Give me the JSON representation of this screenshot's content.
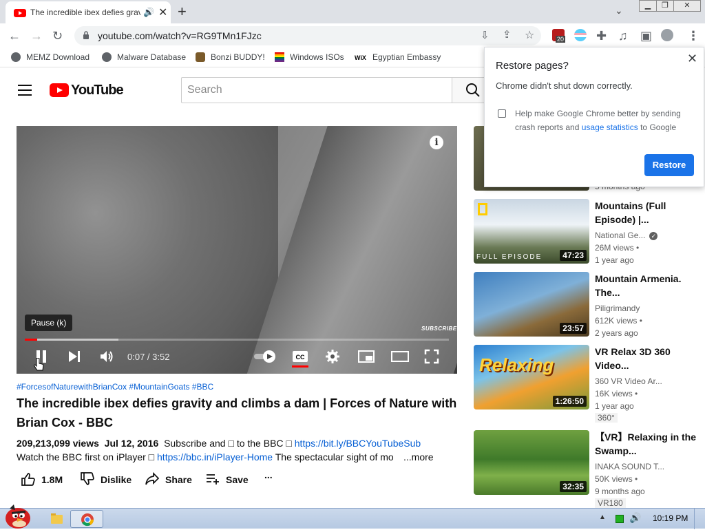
{
  "browser": {
    "tab_title": "The incredible ibex defies gravity and climbs a dam",
    "new_tab_label": "+",
    "url": "youtube.com/watch?v=RG9TMn1FJzc",
    "extension_badge": "20",
    "window_controls": [
      "minimize-button",
      "maximize-button",
      "close-button"
    ]
  },
  "bookmarks": [
    {
      "label": "MEMZ Download",
      "icon": "globe-icon"
    },
    {
      "label": "Malware Database",
      "icon": "globe-icon"
    },
    {
      "label": "Bonzi BUDDY!",
      "icon": "bonzi-icon"
    },
    {
      "label": "Windows ISOs",
      "icon": "windows-flag-icon"
    },
    {
      "label": "Egyptian Embassy",
      "icon": "wix-icon"
    }
  ],
  "youtube": {
    "logo_text": "YouTube",
    "search_placeholder": "Search"
  },
  "player": {
    "tooltip": "Pause (k)",
    "time": "0:07 / 3:52",
    "watermark": "SUBSCRIBE",
    "progress_played": 0.03,
    "progress_loaded": 0.22
  },
  "video": {
    "hashtags": "#ForcesofNaturewithBrianCox #MountainGoats #BBC",
    "title": "The incredible ibex defies gravity and climbs a dam | Forces of Nature with Brian Cox - BBC",
    "views": "209,213,099 views",
    "date": "Jul 12, 2016",
    "desc_a": "Subscribe and □ to the BBC □",
    "desc_link1": "https://bit.ly/BBCYouTubeSub",
    "desc_b": "Watch the BBC first on iPlayer □",
    "desc_link2": "https://bbc.in/iPlayer-Home",
    "desc_c": "The spectacular sight of mo",
    "more": "...more",
    "likes": "1.8M",
    "dislike": "Dislike",
    "share": "Share",
    "save": "Save",
    "overflow": "..."
  },
  "sidebar": [
    {
      "title": "",
      "channel": "",
      "views": "",
      "age": "5 months ago",
      "duration": ""
    },
    {
      "title": "Mountains (Full Episode) |...",
      "channel": "National Ge...",
      "views": "26M views •",
      "age": "1 year ago",
      "duration": "47:23",
      "overlay": "FULL EPISODE"
    },
    {
      "title": "Mountain Armenia. The...",
      "channel": "Piligrimandy",
      "views": "612K views •",
      "age": "2 years ago",
      "duration": "23:57"
    },
    {
      "title": "VR Relax 3D 360 Video...",
      "channel": "360 VR Video Ar...",
      "views": "16K views •",
      "age": "1 year ago",
      "duration": "1:26:50",
      "tag": "360°",
      "overlay": "Relaxing"
    },
    {
      "title": "【VR】Relaxing in the Swamp...",
      "channel": "INAKA SOUND T...",
      "views": "50K views •",
      "age": "9 months ago",
      "duration": "32:35",
      "tag": "VR180"
    }
  ],
  "restore_popup": {
    "title": "Restore pages?",
    "message": "Chrome didn't shut down correctly.",
    "help_prefix": "Help make Google Chrome better by sending crash reports and ",
    "help_link": "usage statistics",
    "help_suffix": " to Google",
    "button": "Restore"
  },
  "taskbar": {
    "clock": "10:19 PM"
  },
  "colors": {
    "youtube_red": "#ff0000",
    "link_blue": "#065fd4",
    "chrome_blue": "#1a73e8"
  }
}
